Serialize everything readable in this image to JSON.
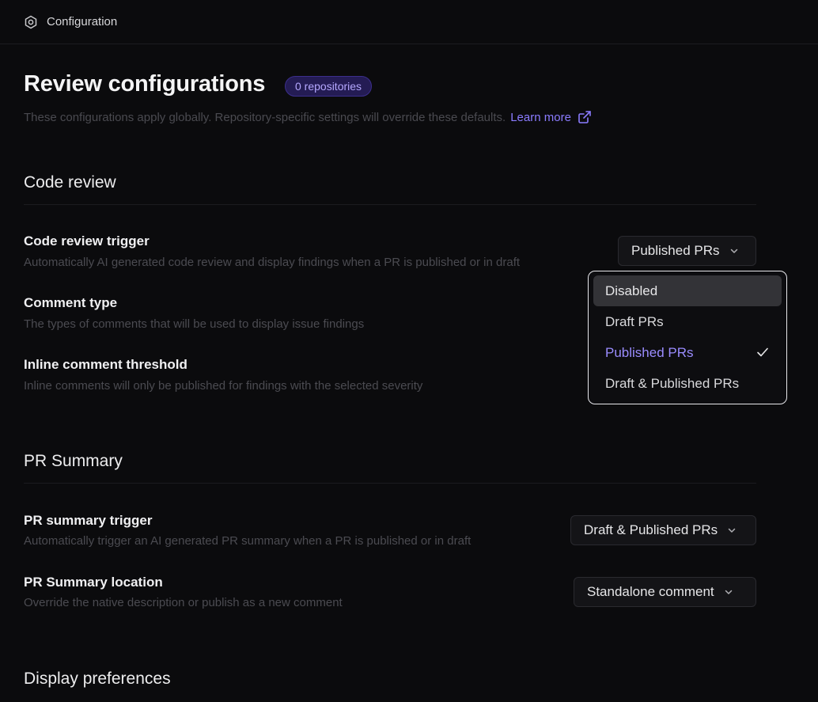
{
  "topbar": {
    "breadcrumb": "Configuration",
    "icon": "gear-icon"
  },
  "page": {
    "title": "Review configurations",
    "badge": "0 repositories",
    "subtitle": "These configurations apply globally. Repository-specific settings will override these defaults.",
    "learn_more": "Learn more"
  },
  "sections": {
    "code_review": {
      "title": "Code review",
      "trigger": {
        "label": "Code review trigger",
        "description": "Automatically AI generated code review and display findings when a PR is published or in draft",
        "value": "Published PRs"
      },
      "comment_type": {
        "label": "Comment type",
        "description": "The types of comments that will be used to display issue findings"
      },
      "threshold": {
        "label": "Inline comment threshold",
        "description": "Inline comments will only be published for findings with the selected severity"
      }
    },
    "pr_summary": {
      "title": "PR Summary",
      "trigger": {
        "label": "PR summary trigger",
        "description": "Automatically trigger an AI generated PR summary when a PR is published or in draft",
        "value": "Draft & Published PRs"
      },
      "location": {
        "label": "PR Summary location",
        "description": "Override the native description or publish as a new comment",
        "value": "Standalone comment"
      }
    },
    "display": {
      "title": "Display preferences"
    }
  },
  "dropdown": {
    "options": [
      "Disabled",
      "Draft PRs",
      "Published PRs",
      "Draft & Published PRs"
    ],
    "selected": "Published PRs",
    "highlighted": "Disabled"
  },
  "colors": {
    "accent": "#8b7cff",
    "background": "#0b0b0d",
    "badge_bg": "#241c54"
  }
}
